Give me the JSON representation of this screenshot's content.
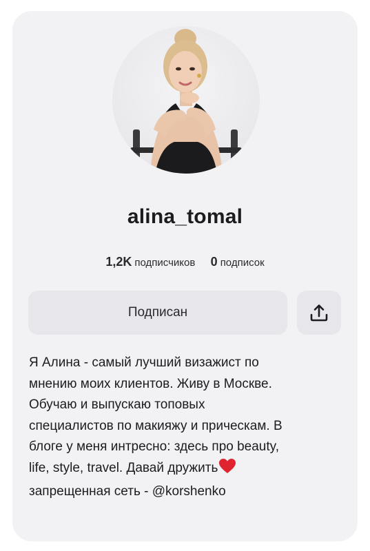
{
  "profile": {
    "username": "alina_tomal",
    "followers_count": "1,2K",
    "followers_label": "подписчиков",
    "following_count": "0",
    "following_label": "подписок"
  },
  "actions": {
    "subscribe_label": "Подписан",
    "share_icon": "share-upload-icon"
  },
  "bio": {
    "lines": [
      "Я Алина - самый лучший визажист по",
      "мнению моих клиентов. Живу в Москве.",
      "Обучаю и выпускаю топовых",
      "специалистов по макияжу и прическам. В",
      "блоге у меня интресно: здесь про beauty,",
      "life, style, travel. Давай дружить",
      "запрещенная сеть - @korshenko"
    ],
    "heart_icon": "red-heart-emoji",
    "heart_color": "#e0242f"
  },
  "colors": {
    "card_background": "#f2f2f4",
    "button_background": "#e6e6eb",
    "text": "#1c1c1e"
  }
}
